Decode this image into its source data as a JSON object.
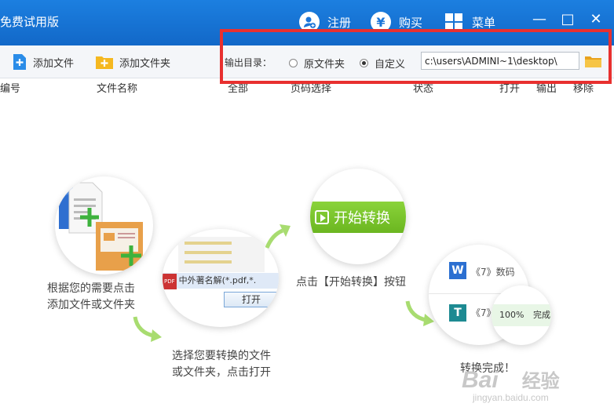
{
  "app": {
    "title": "免费试用版",
    "actions": [
      {
        "label": "注册",
        "icon": "user-add-icon"
      },
      {
        "label": "购买",
        "icon": "yen-icon"
      },
      {
        "label": "菜单",
        "icon": "grid-menu-icon"
      }
    ],
    "window_controls": {
      "minimize": "—",
      "maximize": "□",
      "close": "✕"
    }
  },
  "toolbar": {
    "add_file": "添加文件",
    "add_folder": "添加文件夹",
    "output_label": "输出目录：",
    "option_original": "原文件夹",
    "option_custom": "自定义",
    "selected": "自定义",
    "path": "c:\\users\\ADMINI~1\\desktop\\"
  },
  "columns": [
    "编号",
    "文件名称",
    "全部",
    "页码选择",
    "状态",
    "打开",
    "输出",
    "移除"
  ],
  "steps": {
    "step1_text": [
      "根据您的需要点击",
      "添加文件或文件夹"
    ],
    "step2_text": [
      "选择您要转换的文件",
      "或文件夹，点击打开"
    ],
    "step2_file_label": "中外著名解",
    "step2_filter": "(*.pdf,*.",
    "step2_open_button": "打开",
    "step3_text": "点击【开始转换】按钮",
    "step3_button": "开始转换",
    "step4_text": "转换完成！",
    "step4_doc": "《7》数码",
    "step4_doc2": "《7》",
    "step4_progress": "100%",
    "step4_status": "完成"
  },
  "colors": {
    "title_bar": "#1c7fe0",
    "highlight": "#e8302f",
    "accent_green": "#7ac12b"
  },
  "watermark": {
    "brand": "Bai",
    "brand2": "经验",
    "url": "jingyan.baidu.com"
  }
}
